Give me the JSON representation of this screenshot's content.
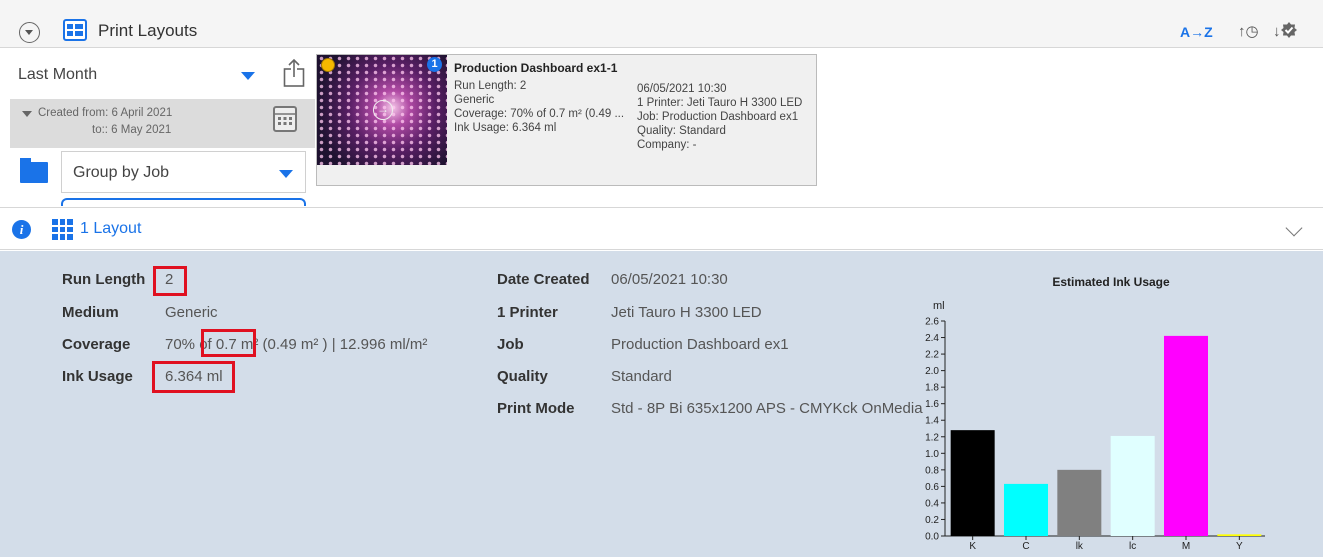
{
  "header": {
    "title": "Print Layouts",
    "sort_az": "A→Z",
    "sort_time": "↑◷",
    "sort_check": "↓"
  },
  "filters": {
    "period": "Last Month",
    "created_from": "Created from: 6 April 2021",
    "created_to": "to:: 6 May 2021",
    "group_by": "Group by Job"
  },
  "card": {
    "title": "Production Dashboard ex1-1",
    "info_badge": "1",
    "left": [
      "Run Length: 2",
      "Generic",
      "Coverage:  70% of 0.7 m² (0.49 ...",
      "Ink Usage: 6.364 ml"
    ],
    "right": [
      "06/05/2021 10:30",
      "1 Printer: Jeti Tauro H 3300 LED",
      "Job: Production Dashboard ex1",
      "Quality: Standard",
      "Company:  -"
    ]
  },
  "layout_bar": {
    "count_label": "1 Layout",
    "info_glyph": "i"
  },
  "details": {
    "left": [
      {
        "label": "Run Length",
        "value": "2"
      },
      {
        "label": "Medium",
        "value": "Generic"
      },
      {
        "label": "Coverage",
        "value": "70% of 0.7 m² (0.49 m² )  |  12.996 ml/m²"
      },
      {
        "label": "Ink Usage",
        "value": "6.364 ml"
      }
    ],
    "right": [
      {
        "label": "Date Created",
        "value": "06/05/2021 10:30"
      },
      {
        "label": "1 Printer",
        "value": "Jeti Tauro H 3300 LED"
      },
      {
        "label": "Job",
        "value": "Production Dashboard ex1"
      },
      {
        "label": "Quality",
        "value": "Standard"
      },
      {
        "label": "Print Mode",
        "value": "Std - 8P Bi 635x1200 APS - CMYKck OnMedia"
      }
    ]
  },
  "chart_data": {
    "type": "bar",
    "title": "Estimated Ink Usage",
    "ylabel": "ml",
    "ylim": [
      0,
      2.6
    ],
    "yticks": [
      "0.0",
      "0.2",
      "0.4",
      "0.6",
      "0.8",
      "1.0",
      "1.2",
      "1.4",
      "1.6",
      "1.8",
      "2.0",
      "2.2",
      "2.4",
      "2.6"
    ],
    "categories": [
      "K",
      "C",
      "lk",
      "lc",
      "M",
      "Y"
    ],
    "values": [
      1.28,
      0.63,
      0.8,
      1.21,
      2.42,
      0.02
    ],
    "colors": [
      "#000000",
      "#00ffff",
      "#808080",
      "#e0ffff",
      "#ff00ff",
      "#ffff00"
    ]
  }
}
